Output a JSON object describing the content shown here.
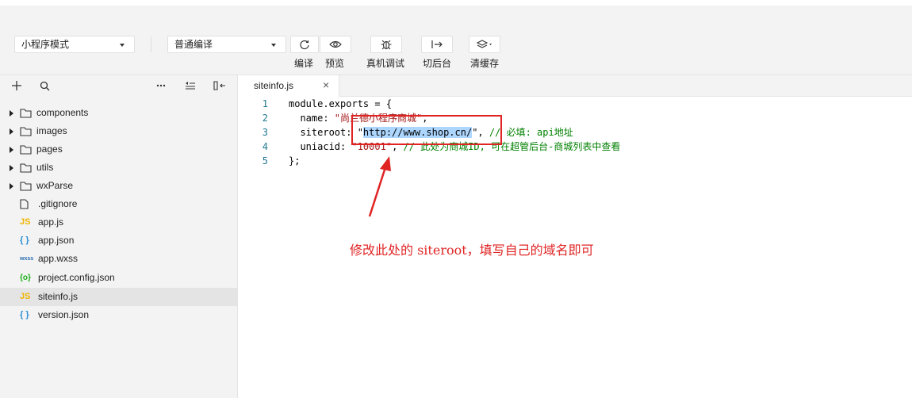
{
  "toolbar": {
    "mode_select": "小程序模式",
    "compile_select": "普通编译",
    "buttons": [
      {
        "label": "编译",
        "icon": "refresh-icon"
      },
      {
        "label": "预览",
        "icon": "eye-icon"
      },
      {
        "label": "真机调试",
        "icon": "bug-icon"
      },
      {
        "label": "切后台",
        "icon": "switch-icon"
      },
      {
        "label": "清缓存",
        "icon": "layers-icon"
      }
    ]
  },
  "sidebar": {
    "tools": [
      "add-icon",
      "search-icon",
      "more-icon",
      "collapse-icon",
      "split-icon"
    ],
    "items": [
      {
        "label": "components",
        "type": "folder"
      },
      {
        "label": "images",
        "type": "folder"
      },
      {
        "label": "pages",
        "type": "folder"
      },
      {
        "label": "utils",
        "type": "folder"
      },
      {
        "label": "wxParse",
        "type": "folder"
      },
      {
        "label": ".gitignore",
        "type": "file"
      },
      {
        "label": "app.js",
        "type": "js"
      },
      {
        "label": "app.json",
        "type": "json"
      },
      {
        "label": "app.wxss",
        "type": "wxss"
      },
      {
        "label": "project.config.json",
        "type": "config"
      },
      {
        "label": "siteinfo.js",
        "type": "js",
        "selected": true
      },
      {
        "label": "version.json",
        "type": "json"
      }
    ]
  },
  "editor": {
    "tab": {
      "name": "siteinfo.js",
      "close": "×"
    },
    "lines": [
      {
        "no": "1",
        "pre": "module.exports = {",
        "str": "",
        "post": "",
        "comment": ""
      },
      {
        "no": "2",
        "pre": "  name: ",
        "str": "\"尚兰德小程序商城\"",
        "post": ",",
        "comment": ""
      },
      {
        "no": "3",
        "pre": "  siteroot: \"",
        "sel": "http://www.shop.cn/",
        "post2": "\", ",
        "comment": "// 必填: api地址"
      },
      {
        "no": "4",
        "pre": "  uniacid: ",
        "str": "\"10001\"",
        "post": ", ",
        "comment": "// 此处为商城ID, 可在超管后台-商城列表中查看"
      },
      {
        "no": "5",
        "pre": "};",
        "str": "",
        "post": "",
        "comment": ""
      }
    ],
    "annotation": "修改此处的 siteroot，填写自己的域名即可"
  },
  "colors": {
    "accent_red": "#e02424",
    "string": "#a31515",
    "comment": "#008000",
    "line_number": "#237893"
  }
}
